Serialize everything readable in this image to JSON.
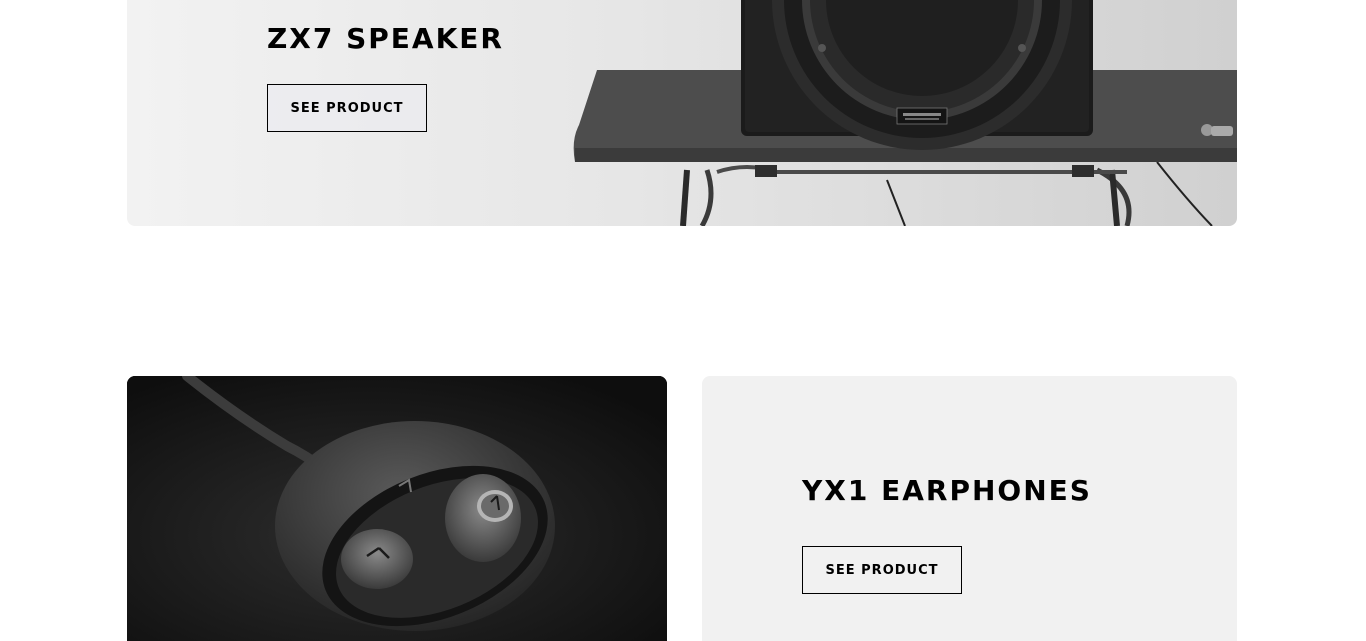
{
  "zx7": {
    "title": "ZX7 SPEAKER",
    "button_label": "SEE PRODUCT"
  },
  "yx1": {
    "title": "YX1 EARPHONES",
    "button_label": "SEE PRODUCT"
  },
  "colors": {
    "text": "#000000",
    "card_bg": "#f1f1f1",
    "page_bg": "#ffffff",
    "earphones_bg": "#1a1a1a"
  }
}
